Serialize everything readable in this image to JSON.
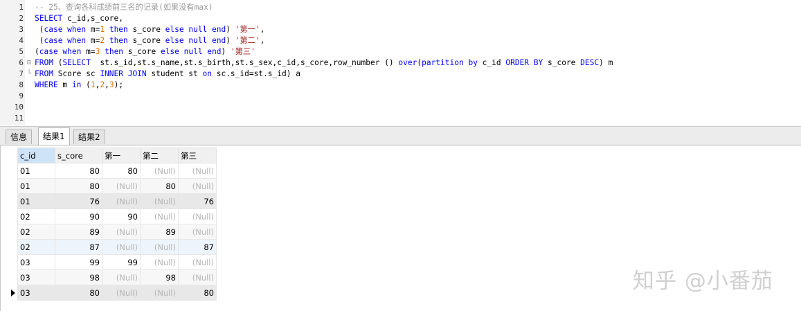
{
  "editor": {
    "lines": [
      {
        "n": "1",
        "fold": "",
        "tokens": [
          [
            "c",
            "-- 25、查询各科成绩前三名的记录(如果没有max)"
          ]
        ]
      },
      {
        "n": "2",
        "fold": "",
        "tokens": [
          [
            "k",
            "SELECT"
          ],
          [
            "p",
            " c_id,s_core,"
          ]
        ]
      },
      {
        "n": "3",
        "fold": "",
        "tokens": [
          [
            "p",
            " ("
          ],
          [
            "k",
            "case when"
          ],
          [
            "p",
            " m="
          ],
          [
            "n",
            "1"
          ],
          [
            "p",
            " "
          ],
          [
            "k",
            "then"
          ],
          [
            "p",
            " s_core "
          ],
          [
            "k",
            "else null end"
          ],
          [
            "p",
            ") "
          ],
          [
            "s",
            "'第一'"
          ],
          [
            "p",
            ","
          ]
        ]
      },
      {
        "n": "4",
        "fold": "",
        "tokens": [
          [
            "p",
            " ("
          ],
          [
            "k",
            "case when"
          ],
          [
            "p",
            " m="
          ],
          [
            "n",
            "2"
          ],
          [
            "p",
            " "
          ],
          [
            "k",
            "then"
          ],
          [
            "p",
            " s_core "
          ],
          [
            "k",
            "else null end"
          ],
          [
            "p",
            ") "
          ],
          [
            "s",
            "'第二'"
          ],
          [
            "p",
            ","
          ]
        ]
      },
      {
        "n": "5",
        "fold": "",
        "tokens": [
          [
            "p",
            "("
          ],
          [
            "k",
            "case when"
          ],
          [
            "p",
            " m="
          ],
          [
            "n",
            "3"
          ],
          [
            "p",
            " "
          ],
          [
            "k",
            "then"
          ],
          [
            "p",
            " s_core "
          ],
          [
            "k",
            "else null end"
          ],
          [
            "p",
            ") "
          ],
          [
            "s",
            "'第三'"
          ]
        ]
      },
      {
        "n": "6",
        "fold": "⊟",
        "tokens": [
          [
            "k",
            "FROM"
          ],
          [
            "p",
            " ("
          ],
          [
            "k",
            "SELECT"
          ],
          [
            "p",
            "  st.s_id,st.s_name,st.s_birth,st.s_sex,c_id,s_core,row_number () "
          ],
          [
            "k",
            "over"
          ],
          [
            "p",
            "("
          ],
          [
            "k",
            "partition by"
          ],
          [
            "p",
            " c_id "
          ],
          [
            "k",
            "ORDER BY"
          ],
          [
            "p",
            " s_core "
          ],
          [
            "k",
            "DESC"
          ],
          [
            "p",
            ") m"
          ]
        ]
      },
      {
        "n": "7",
        "fold": "└",
        "tokens": [
          [
            "k",
            "FROM"
          ],
          [
            "p",
            " Score sc "
          ],
          [
            "k",
            "INNER JOIN"
          ],
          [
            "p",
            " student st "
          ],
          [
            "k",
            "on"
          ],
          [
            "p",
            " sc.s_id=st.s_id) a"
          ]
        ]
      },
      {
        "n": "8",
        "fold": "",
        "tokens": [
          [
            "k",
            "WHERE"
          ],
          [
            "p",
            " m "
          ],
          [
            "k",
            "in"
          ],
          [
            "p",
            " ("
          ],
          [
            "n",
            "1"
          ],
          [
            "p",
            ","
          ],
          [
            "n",
            "2"
          ],
          [
            "p",
            ","
          ],
          [
            "n",
            "3"
          ],
          [
            "p",
            ");"
          ]
        ]
      },
      {
        "n": "9",
        "fold": "",
        "tokens": []
      },
      {
        "n": "10",
        "fold": "",
        "tokens": []
      },
      {
        "n": "11",
        "fold": "",
        "tokens": []
      }
    ]
  },
  "tabs": [
    {
      "label": "信息",
      "active": false
    },
    {
      "label": "结果1",
      "active": true
    },
    {
      "label": "结果2",
      "active": false
    }
  ],
  "grid": {
    "columns": [
      "c_id",
      "s_core",
      "第一",
      "第二",
      "第三"
    ],
    "null_label": "(Null)",
    "rows": [
      [
        "01",
        "80",
        "80",
        null,
        null
      ],
      [
        "01",
        "80",
        null,
        "80",
        null
      ],
      [
        "01",
        "76",
        null,
        null,
        "76"
      ],
      [
        "02",
        "90",
        "90",
        null,
        null
      ],
      [
        "02",
        "89",
        null,
        "89",
        null
      ],
      [
        "02",
        "87",
        null,
        null,
        "87"
      ],
      [
        "03",
        "99",
        "99",
        null,
        null
      ],
      [
        "03",
        "98",
        null,
        "98",
        null
      ],
      [
        "03",
        "80",
        null,
        null,
        "80"
      ]
    ]
  },
  "watermark": "知乎 @小番茄"
}
